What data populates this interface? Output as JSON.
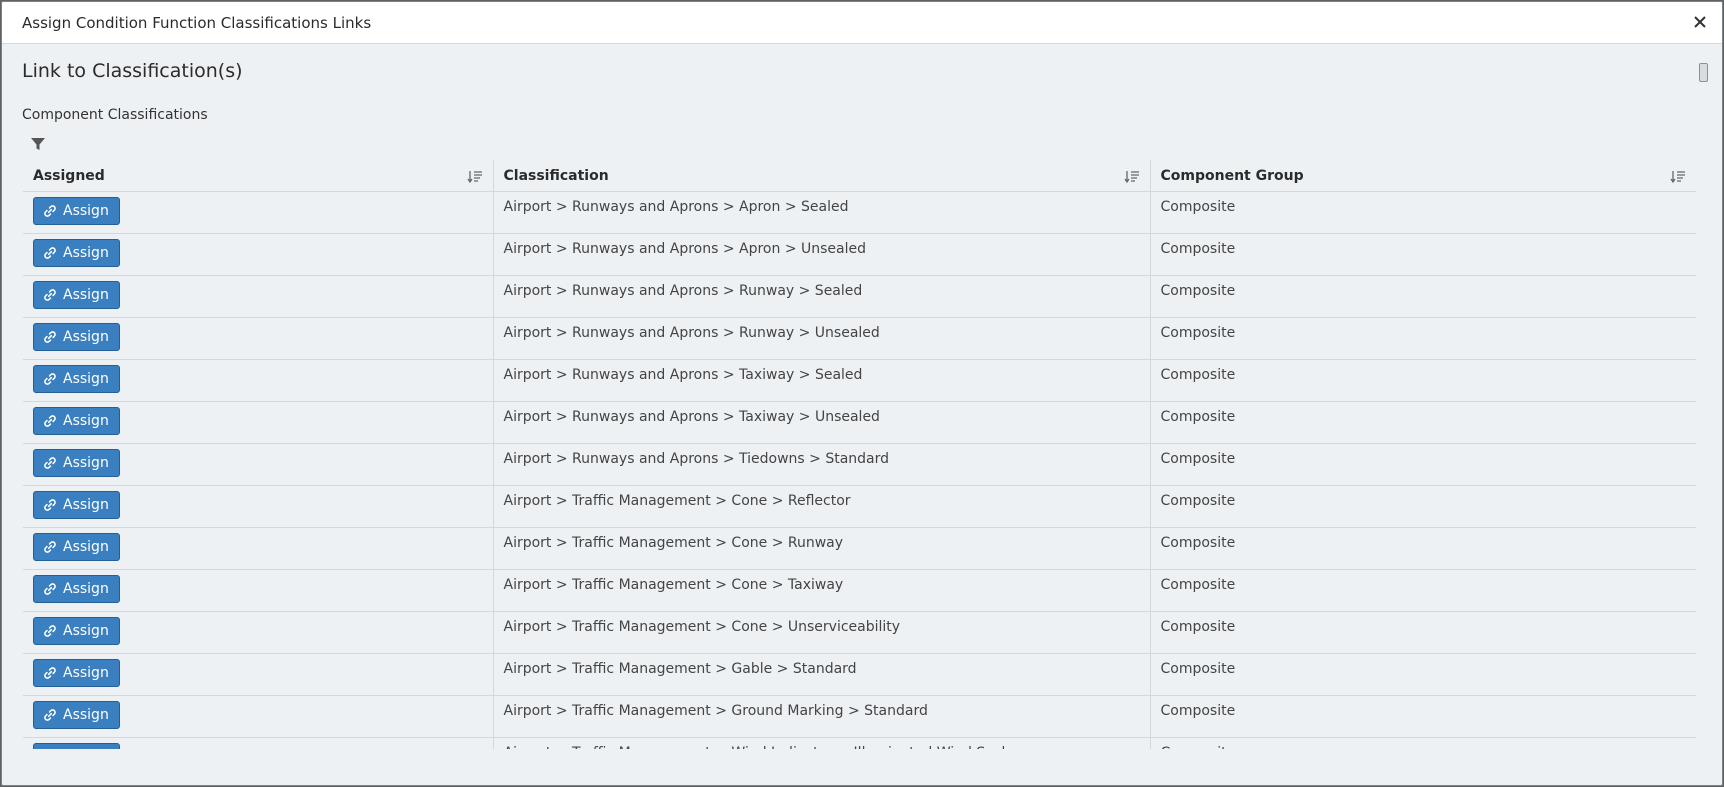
{
  "dialog": {
    "title": "Assign Condition Function Classifications Links"
  },
  "section": {
    "title": "Link to Classification(s)",
    "subtitle": "Component Classifications"
  },
  "table": {
    "columns": [
      "Assigned",
      "Classification",
      "Component Group"
    ],
    "button_label": "Assign",
    "rows": [
      {
        "classification": "Airport > Runways and Aprons > Apron > Sealed",
        "group": "Composite"
      },
      {
        "classification": "Airport > Runways and Aprons > Apron > Unsealed",
        "group": "Composite"
      },
      {
        "classification": "Airport > Runways and Aprons > Runway > Sealed",
        "group": "Composite"
      },
      {
        "classification": "Airport > Runways and Aprons > Runway > Unsealed",
        "group": "Composite"
      },
      {
        "classification": "Airport > Runways and Aprons > Taxiway > Sealed",
        "group": "Composite"
      },
      {
        "classification": "Airport > Runways and Aprons > Taxiway > Unsealed",
        "group": "Composite"
      },
      {
        "classification": "Airport > Runways and Aprons > Tiedowns > Standard",
        "group": "Composite"
      },
      {
        "classification": "Airport > Traffic Management > Cone > Reflector",
        "group": "Composite"
      },
      {
        "classification": "Airport > Traffic Management > Cone > Runway",
        "group": "Composite"
      },
      {
        "classification": "Airport > Traffic Management > Cone > Taxiway",
        "group": "Composite"
      },
      {
        "classification": "Airport > Traffic Management > Cone > Unserviceability",
        "group": "Composite"
      },
      {
        "classification": "Airport > Traffic Management > Gable > Standard",
        "group": "Composite"
      },
      {
        "classification": "Airport > Traffic Management > Ground Marking > Standard",
        "group": "Composite"
      },
      {
        "classification": "Airport > Traffic Management > Wind Indicator > Illuminated Wind Sock",
        "group": "Composite"
      }
    ]
  },
  "icons": {
    "close": "close-icon",
    "filter": "filter-icon",
    "sort": "sort-icon",
    "link": "link-icon"
  },
  "colors": {
    "button_bg": "#3a7fc0",
    "dialog_bg": "#eef1f4"
  }
}
